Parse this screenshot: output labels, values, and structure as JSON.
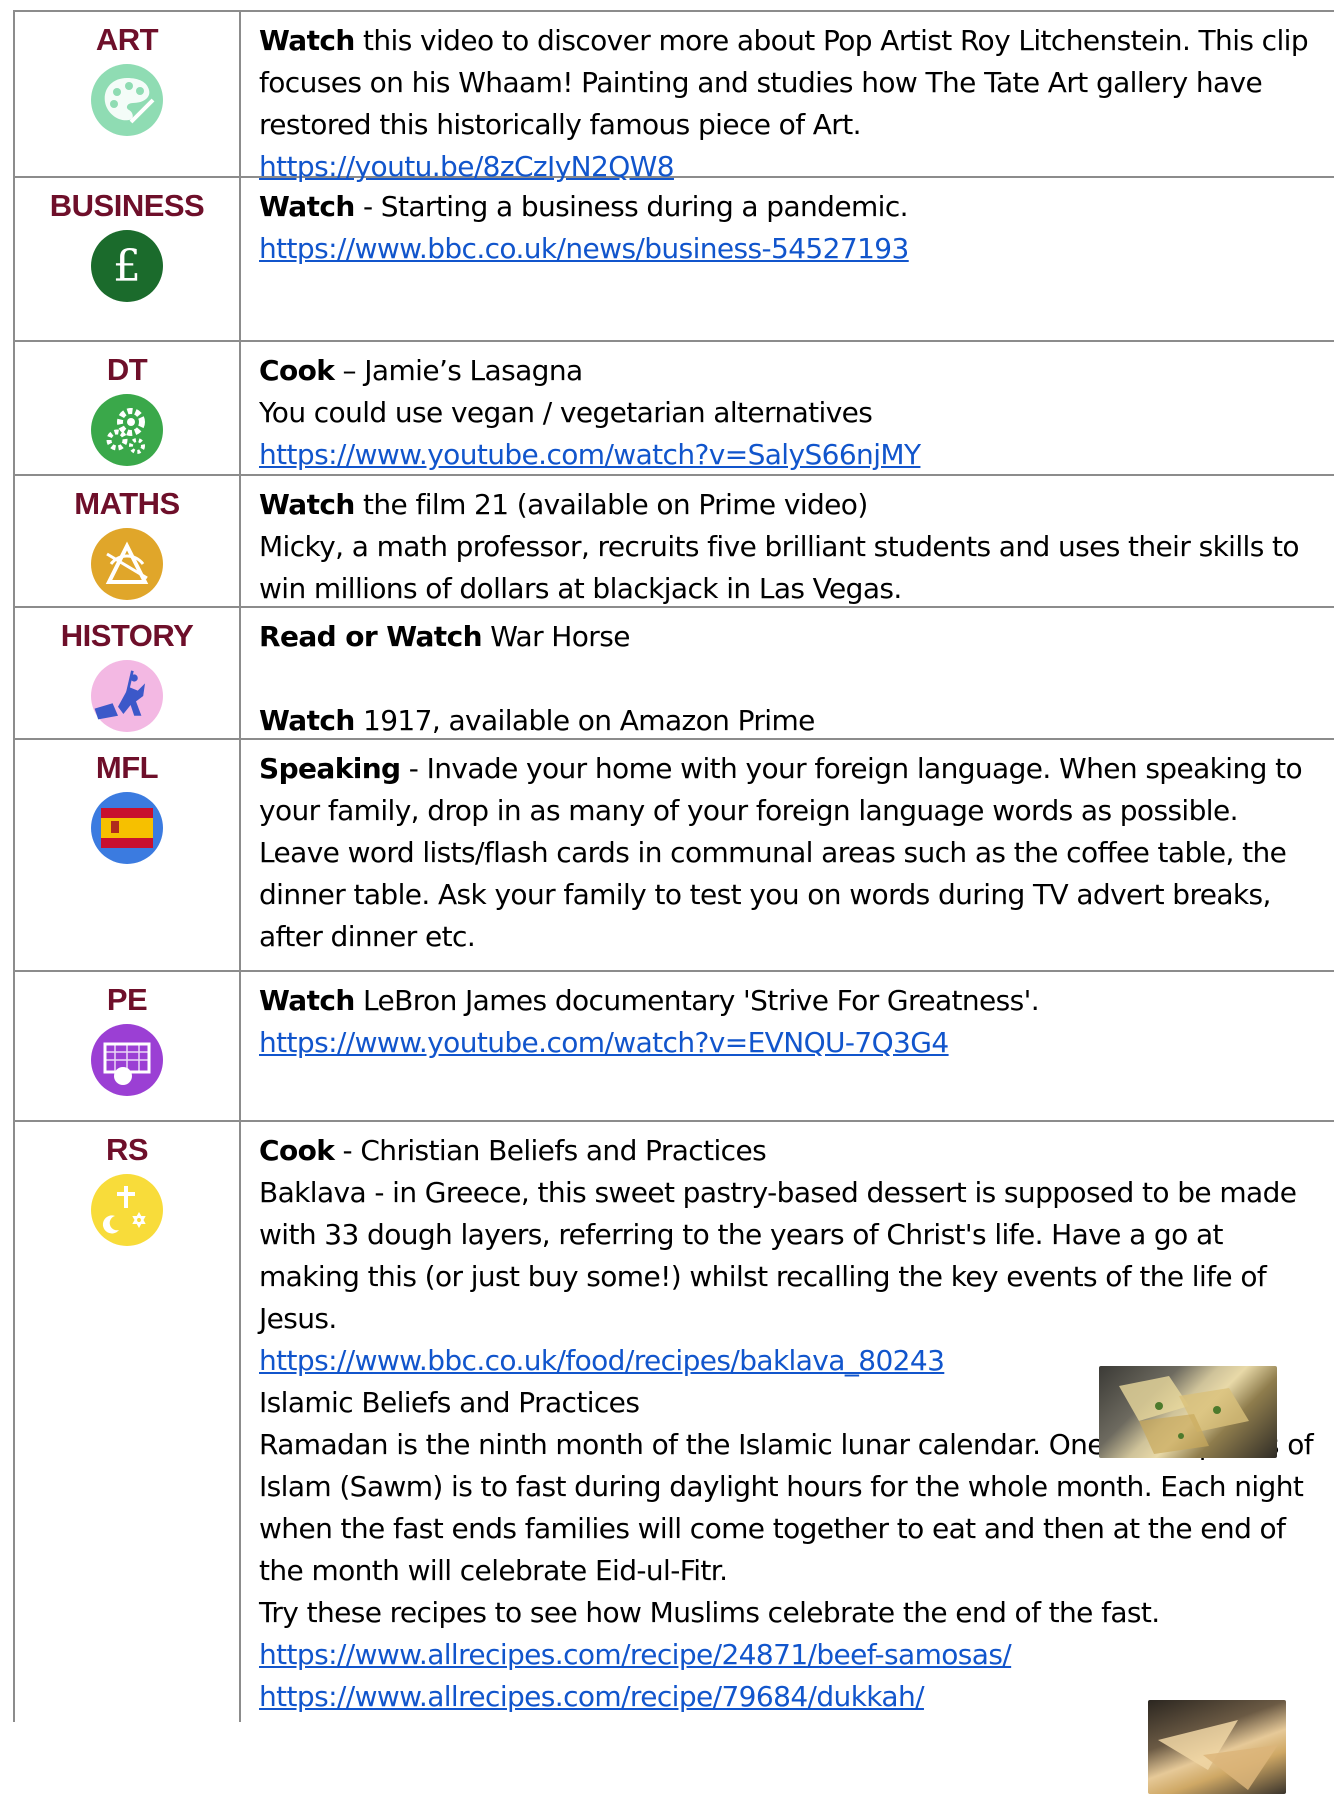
{
  "rows": [
    {
      "subject": "ART",
      "icon": "palette-icon",
      "color": "#8fdcb3",
      "lines": [
        {
          "bold": "Watch",
          "text": " this video to discover more about Pop Artist Roy Litchenstein. This clip focuses on his Whaam! Painting and studies how The Tate Art gallery have restored this historically famous piece of Art."
        },
        {
          "link": "https://youtu.be/8zCzIyN2QW8"
        }
      ]
    },
    {
      "subject": "BUSINESS",
      "icon": "pound-sign-icon",
      "color": "#1b6b2c",
      "lines": [
        {
          "bold": "Watch",
          "text": " - Starting a business during a pandemic."
        },
        {
          "link": "https://www.bbc.co.uk/news/business-54527193"
        }
      ]
    },
    {
      "subject": "DT",
      "icon": "gears-icon",
      "color": "#3aa84a",
      "lines": [
        {
          "bold": "Cook",
          "text": " – Jamie’s Lasagna"
        },
        {
          "text": "You could use vegan / vegetarian alternatives"
        },
        {
          "link": "https://www.youtube.com/watch?v=SalyS66njMY"
        }
      ]
    },
    {
      "subject": "MATHS",
      "icon": "geometry-icon",
      "color": "#e0a62a",
      "lines": [
        {
          "bold": "Watch",
          "text": " the film 21 (available on Prime video)"
        },
        {
          "text": "Micky, a math professor, recruits five brilliant students and uses their skills to win millions of dollars at blackjack in Las Vegas."
        }
      ]
    },
    {
      "subject": "HISTORY",
      "icon": "knight-horse-icon",
      "color": "#f3b8e3",
      "lines": [
        {
          "bold": "Read or Watch",
          "text": " War Horse"
        },
        {
          "spacer": true
        },
        {
          "bold": "Watch",
          "text": " 1917, available on Amazon Prime"
        }
      ]
    },
    {
      "subject": "MFL",
      "icon": "spanish-flag-icon",
      "color": "#3b7be0",
      "lines": [
        {
          "bold": "Speaking",
          "text": " - Invade your home with your foreign language.  When speaking to your family, drop in as many of your foreign language words as possible.  Leave word lists/flash cards in communal areas such as the coffee table, the dinner table.  Ask your family to test you on words during TV advert breaks, after dinner etc."
        }
      ]
    },
    {
      "subject": "PE",
      "icon": "football-goal-icon",
      "color": "#9b3fd4",
      "lines": [
        {
          "bold": "Watch",
          "text": " LeBron James documentary 'Strive For Greatness'."
        },
        {
          "link": "https://www.youtube.com/watch?v=EVNQU-7Q3G4"
        }
      ]
    },
    {
      "subject": "RS",
      "icon": "religious-symbols-icon",
      "color": "#f8dc3a",
      "lines": [
        {
          "bold": "Cook",
          "text": " - Christian Beliefs and Practices"
        },
        {
          "text": "Baklava - in Greece, this sweet pastry-based dessert is supposed to be made with 33 dough layers, referring to the years of Christ's life. Have a go at making this (or just buy some!) whilst recalling the key events of the life of Jesus."
        },
        {
          "link": "https://www.bbc.co.uk/food/recipes/baklava_80243"
        },
        {
          "text": "Islamic Beliefs and Practices"
        },
        {
          "text": "Ramadan is the ninth month of the Islamic lunar calendar. One of the pillars of Islam (Sawm) is to fast during daylight hours for the whole month.  Each night when the fast ends families will come together to eat and then at the end of the month will celebrate Eid-ul-Fitr."
        },
        {
          "text": "Try these recipes to see how Muslims celebrate the end of the fast."
        },
        {
          "link": "https://www.allrecipes.com/recipe/24871/beef-samosas/"
        },
        {
          "link": "https://www.allrecipes.com/recipe/79684/dukkah/"
        }
      ]
    }
  ]
}
